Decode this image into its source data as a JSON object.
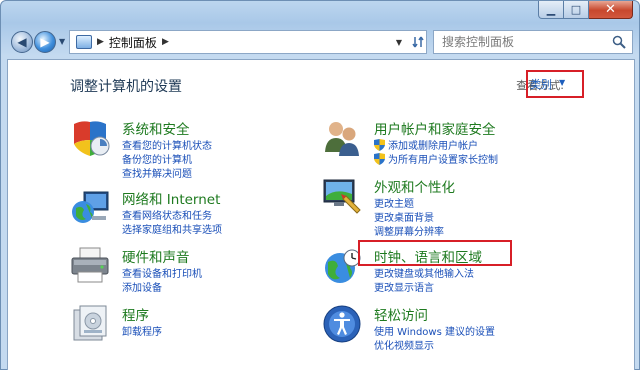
{
  "window": {
    "minimize_glyph": "▁",
    "maximize_glyph": "□",
    "close_glyph": "✕"
  },
  "toolbar": {
    "back_glyph": "◀",
    "forward_glyph": "▶",
    "address_path": "控制面板",
    "address_sep": "▶",
    "address_trailing_sep": "▶",
    "search_placeholder": "搜索控制面板"
  },
  "header": {
    "title": "调整计算机的设置",
    "view_by_label": "查看方式:",
    "view_by_value": "类别",
    "view_by_caret": "▼"
  },
  "categories": [
    {
      "icon": "shield-security-icon",
      "title": "系统和安全",
      "links": [
        "查看您的计算机状态",
        "备份您的计算机",
        "查找并解决问题"
      ]
    },
    {
      "icon": "network-globe-icon",
      "title": "网络和 Internet",
      "links": [
        "查看网络状态和任务",
        "选择家庭组和共享选项"
      ]
    },
    {
      "icon": "printer-icon",
      "title": "硬件和声音",
      "links": [
        "查看设备和打印机",
        "添加设备"
      ]
    },
    {
      "icon": "programs-icon",
      "title": "程序",
      "links": [
        "卸载程序"
      ]
    },
    {
      "icon": "users-icon",
      "title": "用户帐户和家庭安全",
      "links": [
        "添加或删除用户帐户",
        "为所有用户设置家长控制"
      ]
    },
    {
      "icon": "appearance-icon",
      "title": "外观和个性化",
      "links": [
        "更改主题",
        "更改桌面背景",
        "调整屏幕分辨率"
      ]
    },
    {
      "icon": "clock-globe-icon",
      "title": "时钟、语言和区域",
      "links": [
        "更改键盘或其他输入法",
        "更改显示语言"
      ]
    },
    {
      "icon": "ease-of-access-icon",
      "title": "轻松访问",
      "links": [
        "使用 Windows 建议的设置",
        "优化视频显示"
      ]
    }
  ],
  "colors": {
    "title_green": "#1e7a1f",
    "link_blue": "#1a4fb8",
    "highlight_red": "#d71f27"
  }
}
